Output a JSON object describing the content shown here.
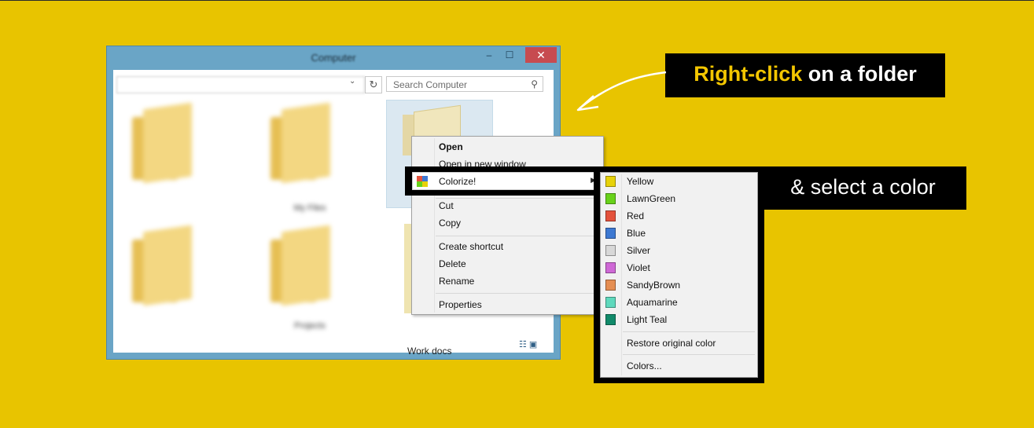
{
  "window": {
    "title": "Computer",
    "search_placeholder": "Search Computer",
    "folders": [
      {
        "label": "My Files"
      },
      {
        "label": "Projects"
      }
    ],
    "selected_folder_label": "",
    "background_folder_label": "Work docs",
    "controls": {
      "minimize": "‒",
      "maximize": "☐",
      "close": "✕"
    }
  },
  "context_menu": {
    "open": "Open",
    "open_new_window": "Open in new window",
    "colorize": "Colorize!",
    "cut": "Cut",
    "copy": "Copy",
    "create_shortcut": "Create shortcut",
    "delete": "Delete",
    "rename": "Rename",
    "properties": "Properties"
  },
  "colorize_submenu": {
    "colors": [
      {
        "label": "Yellow",
        "color": "#e7d20a"
      },
      {
        "label": "LawnGreen",
        "color": "#68d21a"
      },
      {
        "label": "Red",
        "color": "#e4523c"
      },
      {
        "label": "Blue",
        "color": "#3e79d2"
      },
      {
        "label": "Silver",
        "color": "#d8d8d8"
      },
      {
        "label": "Violet",
        "color": "#cf69d6"
      },
      {
        "label": "SandyBrown",
        "color": "#e58e52"
      },
      {
        "label": "Aquamarine",
        "color": "#5fd9bd"
      },
      {
        "label": "Light Teal",
        "color": "#118a6a"
      }
    ],
    "restore": "Restore original color",
    "more": "Colors..."
  },
  "callouts": {
    "first_highlight": "Right-click",
    "first_rest": " on a folder",
    "second": "& select a color"
  },
  "theme": {
    "background": "#e8c400",
    "accent": "#f3c600"
  }
}
